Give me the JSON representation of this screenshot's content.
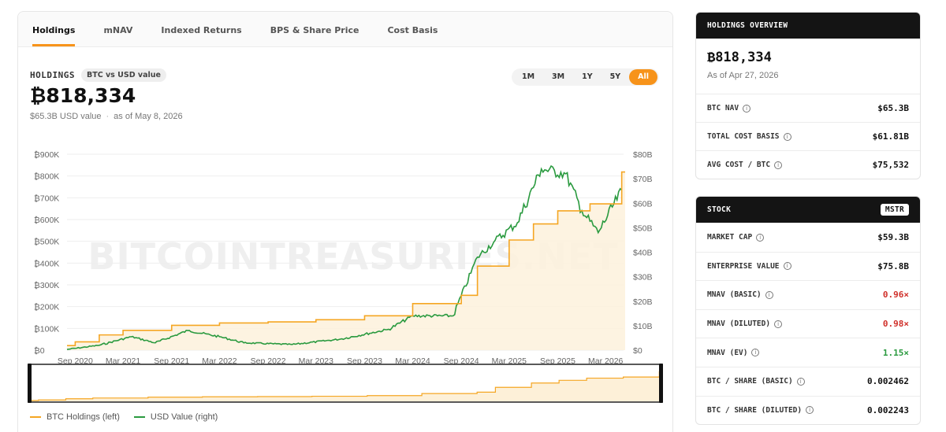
{
  "tabs": [
    "Holdings",
    "mNAV",
    "Indexed Returns",
    "BPS & Share Price",
    "Cost Basis"
  ],
  "active_tab": "Holdings",
  "holdings": {
    "label": "HOLDINGS",
    "badge": "BTC vs USD value",
    "value": "₿818,334",
    "usd_value": "$65.3B USD value",
    "dot": "·",
    "as_of": "as of May 8, 2026"
  },
  "range_buttons": [
    "1M",
    "3M",
    "1Y",
    "5Y",
    "All"
  ],
  "range_selected": "All",
  "watermark": "BITCOINTREASURIES.NET",
  "legend": {
    "btc": "BTC Holdings (left)",
    "usd": "USD Value (right)"
  },
  "colors": {
    "btc": "#f5a623",
    "usd": "#2a9a3f",
    "accent": "#f7931a"
  },
  "chart_data": {
    "type": "line",
    "x_ticks": [
      "Sep 2020",
      "Mar 2021",
      "Sep 2021",
      "Mar 2022",
      "Sep 2022",
      "Mar 2023",
      "Sep 2023",
      "Mar 2024",
      "Sep 2024",
      "Mar 2025",
      "Sep 2025",
      "Mar 2026"
    ],
    "y_left_ticks": [
      "₿0",
      "₿100K",
      "₿200K",
      "₿300K",
      "₿400K",
      "₿500K",
      "₿600K",
      "₿700K",
      "₿800K",
      "₿900K"
    ],
    "y_right_ticks": [
      "$0",
      "$10B",
      "$20B",
      "$30B",
      "$40B",
      "$50B",
      "$60B",
      "$70B",
      "$80B"
    ],
    "ylim_left": [
      0,
      900000
    ],
    "ylim_right": [
      0,
      80
    ],
    "grid": true,
    "series": [
      {
        "name": "BTC Holdings (left)",
        "axis": "left",
        "x": [
          "2020-08",
          "2020-09",
          "2020-12",
          "2021-03",
          "2021-09",
          "2022-03",
          "2022-09",
          "2023-03",
          "2023-09",
          "2024-03",
          "2024-09",
          "2024-11",
          "2025-03",
          "2025-06",
          "2025-09",
          "2026-01",
          "2026-05"
        ],
        "values": [
          21000,
          38000,
          70000,
          91000,
          114000,
          125000,
          130000,
          140000,
          158000,
          214000,
          252000,
          386000,
          506000,
          580000,
          640000,
          672000,
          818334
        ]
      },
      {
        "name": "USD Value (right)",
        "axis": "right",
        "x": [
          "2020-08",
          "2020-12",
          "2021-04",
          "2021-07",
          "2021-11",
          "2022-03",
          "2022-06",
          "2022-12",
          "2023-06",
          "2023-12",
          "2024-03",
          "2024-08",
          "2024-11",
          "2025-01",
          "2025-04",
          "2025-07",
          "2025-10",
          "2025-12",
          "2026-02",
          "2026-05"
        ],
        "values": [
          0.3,
          2.0,
          5.5,
          3.0,
          8.0,
          5.5,
          3.0,
          2.3,
          4.5,
          8.5,
          14.0,
          14.0,
          38.0,
          44.0,
          52.0,
          74.0,
          72.0,
          57.0,
          48.0,
          65.3
        ]
      }
    ]
  },
  "overview": {
    "title": "HOLDINGS OVERVIEW",
    "value": "₿818,334",
    "as_of": "As of Apr 27, 2026",
    "rows": [
      {
        "label": "BTC NAV",
        "value": "$65.3B"
      },
      {
        "label": "TOTAL COST BASIS",
        "value": "$61.81B"
      },
      {
        "label": "AVG COST / BTC",
        "value": "$75,532"
      }
    ]
  },
  "stock": {
    "title": "STOCK",
    "ticker": "MSTR",
    "rows": [
      {
        "label": "MARKET CAP",
        "value": "$59.3B",
        "tone": ""
      },
      {
        "label": "ENTERPRISE VALUE",
        "value": "$75.8B",
        "tone": ""
      },
      {
        "label": "MNAV (BASIC)",
        "value": "0.96×",
        "tone": "red"
      },
      {
        "label": "MNAV (DILUTED)",
        "value": "0.98×",
        "tone": "red"
      },
      {
        "label": "MNAV (EV)",
        "value": "1.15×",
        "tone": "green"
      },
      {
        "label": "BTC / SHARE (BASIC)",
        "value": "0.002462",
        "tone": ""
      },
      {
        "label": "BTC / SHARE (DILUTED)",
        "value": "0.002243",
        "tone": ""
      }
    ]
  },
  "info_glyph": "i"
}
